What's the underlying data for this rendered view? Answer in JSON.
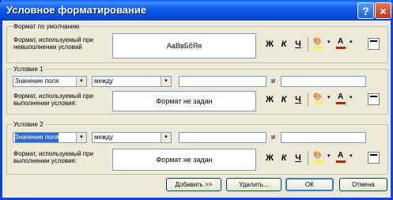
{
  "window": {
    "title": "Условное форматирование"
  },
  "titlebar": {
    "help_label": "?",
    "close_label": "×"
  },
  "default_group": {
    "label": "Формат по умолчанию",
    "desc_line1": "Формат, используемый при",
    "desc_line2": "невыполнении условий",
    "preview_text": "АаВвБбЯя"
  },
  "toolbar": {
    "bold": "Ж",
    "italic": "К",
    "underline": "Ч",
    "fill_icon": "🎨",
    "font_color_letter": "A",
    "dropdown_arrow": "▾",
    "fill_color": "#ffff00",
    "font_color": "#ff0000"
  },
  "condition1": {
    "label": "Условие 1",
    "field_type": "Значение поля",
    "operator": "между",
    "value1": "",
    "value2": "",
    "and_label": "и",
    "desc_line1": "Формат, используемый при",
    "desc_line2": "выполнении условия:",
    "preview_text": "Формат не задан"
  },
  "condition2": {
    "label": "Условие 2",
    "field_type": "Значение поля",
    "operator": "между",
    "value1": "",
    "value2": "",
    "and_label": "и",
    "desc_line1": "Формат, используемый при",
    "desc_line2": "выполнении условия:",
    "preview_text": "Формат не задан"
  },
  "buttons": {
    "add": "Добавить >>",
    "delete": "Удалить...",
    "ok": "ОК",
    "cancel": "Отмена"
  }
}
